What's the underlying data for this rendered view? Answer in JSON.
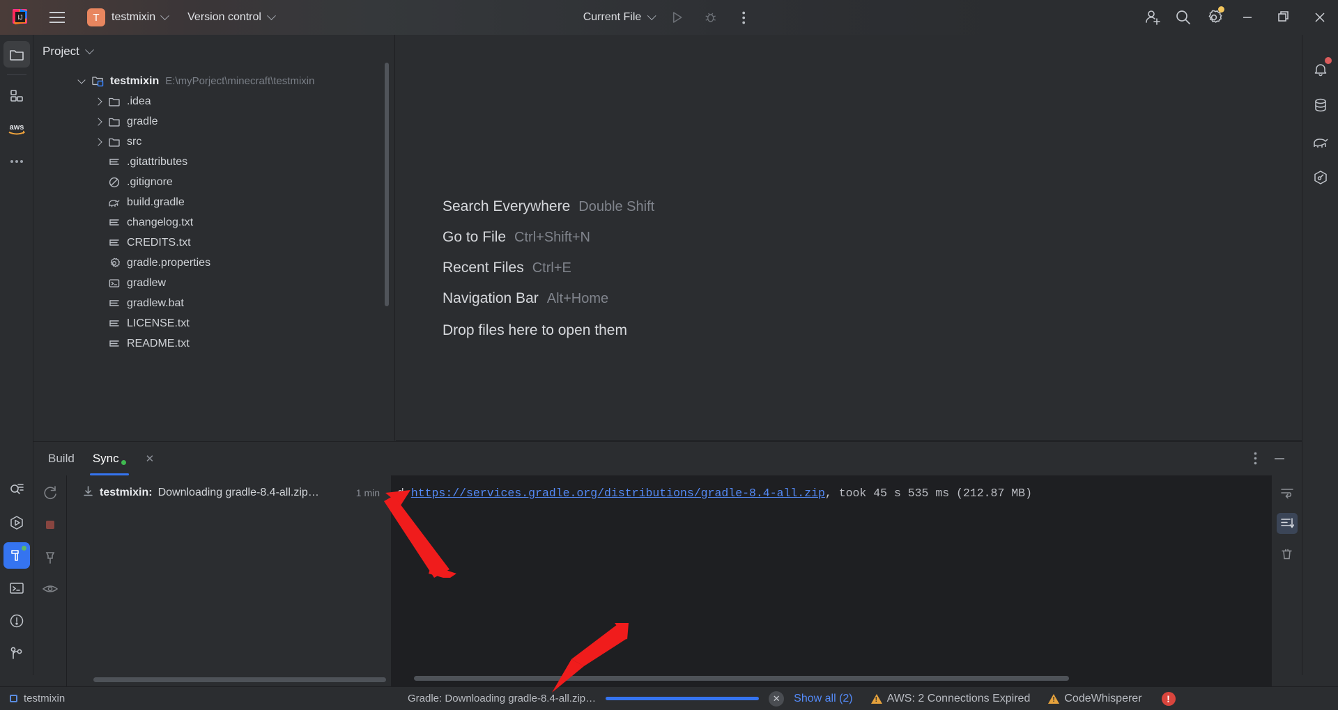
{
  "toolbar": {
    "logo_icon": "intellij-idea-logo",
    "menu_icon": "hamburger-menu-icon",
    "project_badge": "T",
    "project_name": "testmixin",
    "vcs_label": "Version control",
    "run_config": "Current File",
    "run_icon": "run-play-icon",
    "debug_icon": "debug-bug-icon",
    "more_icon": "more-vertical-icon",
    "invite_icon": "add-user-icon",
    "search_icon": "search-icon",
    "settings_icon": "gear-icon",
    "minimize_icon": "window-minimize-icon",
    "maximize_icon": "window-maximize-icon",
    "close_icon": "window-close-icon"
  },
  "left_rail": {
    "items": [
      {
        "name": "project-tool-window",
        "icon": "folder-icon",
        "active": true
      },
      {
        "name": "structure-tool-window",
        "icon": "grid-squares-icon",
        "active": false
      },
      {
        "name": "aws-toolkit",
        "icon": "aws-logo-icon",
        "active": false
      },
      {
        "name": "more-tool-windows",
        "icon": "ellipsis-icon",
        "active": false
      }
    ],
    "bottom_items": [
      {
        "name": "find-tool-window",
        "icon": "find-search-document-icon",
        "active": false
      },
      {
        "name": "run-tool-window",
        "icon": "hexagon-play-icon",
        "active": false
      },
      {
        "name": "build-tool-window",
        "icon": "hammer-icon",
        "active": true,
        "badge": "green-dot"
      },
      {
        "name": "terminal-tool-window",
        "icon": "terminal-icon",
        "active": false
      },
      {
        "name": "problems-tool-window",
        "icon": "exclamation-circle-icon",
        "active": false
      },
      {
        "name": "git-tool-window",
        "icon": "git-branch-icon",
        "active": false
      }
    ]
  },
  "right_rail": {
    "items": [
      {
        "name": "notifications",
        "icon": "bell-icon",
        "badge": "red-dot"
      },
      {
        "name": "database",
        "icon": "database-icon",
        "badge": ""
      },
      {
        "name": "gradle",
        "icon": "gradle-elephant-icon",
        "badge": ""
      },
      {
        "name": "maven",
        "icon": "hexagon-maven-icon",
        "badge": ""
      }
    ]
  },
  "project_panel": {
    "title": "Project",
    "chevron_icon": "chevron-down-icon",
    "tree": [
      {
        "indent": 0,
        "arrow": "down",
        "icon": "module-folder-icon",
        "label": "testmixin",
        "bold": true,
        "path": "E:\\myPorject\\minecraft\\testmixin"
      },
      {
        "indent": 1,
        "arrow": "right",
        "icon": "folder-icon",
        "label": ".idea",
        "bold": false,
        "path": ""
      },
      {
        "indent": 1,
        "arrow": "right",
        "icon": "folder-icon",
        "label": "gradle",
        "bold": false,
        "path": ""
      },
      {
        "indent": 1,
        "arrow": "right",
        "icon": "folder-icon",
        "label": "src",
        "bold": false,
        "path": ""
      },
      {
        "indent": 1,
        "arrow": "none",
        "icon": "text-file-icon",
        "label": ".gitattributes",
        "bold": false,
        "path": ""
      },
      {
        "indent": 1,
        "arrow": "none",
        "icon": "gitignore-icon",
        "label": ".gitignore",
        "bold": false,
        "path": ""
      },
      {
        "indent": 1,
        "arrow": "none",
        "icon": "gradle-elephant-icon",
        "label": "build.gradle",
        "bold": false,
        "path": ""
      },
      {
        "indent": 1,
        "arrow": "none",
        "icon": "text-file-icon",
        "label": "changelog.txt",
        "bold": false,
        "path": ""
      },
      {
        "indent": 1,
        "arrow": "none",
        "icon": "text-file-icon",
        "label": "CREDITS.txt",
        "bold": false,
        "path": ""
      },
      {
        "indent": 1,
        "arrow": "none",
        "icon": "properties-gear-icon",
        "label": "gradle.properties",
        "bold": false,
        "path": ""
      },
      {
        "indent": 1,
        "arrow": "none",
        "icon": "shell-script-icon",
        "label": "gradlew",
        "bold": false,
        "path": ""
      },
      {
        "indent": 1,
        "arrow": "none",
        "icon": "text-file-icon",
        "label": "gradlew.bat",
        "bold": false,
        "path": ""
      },
      {
        "indent": 1,
        "arrow": "none",
        "icon": "text-file-icon",
        "label": "LICENSE.txt",
        "bold": false,
        "path": ""
      },
      {
        "indent": 1,
        "arrow": "none",
        "icon": "text-file-icon",
        "label": "README.txt",
        "bold": false,
        "path": ""
      }
    ]
  },
  "editor": {
    "hints": [
      {
        "name": "Search Everywhere",
        "key": "Double Shift"
      },
      {
        "name": "Go to File",
        "key": "Ctrl+Shift+N"
      },
      {
        "name": "Recent Files",
        "key": "Ctrl+E"
      },
      {
        "name": "Navigation Bar",
        "key": "Alt+Home"
      }
    ],
    "drop_hint": "Drop files here to open them"
  },
  "build_panel": {
    "tabs": [
      {
        "label": "Build",
        "active": false,
        "has_dot": false,
        "closable": false
      },
      {
        "label": "Sync",
        "active": true,
        "has_dot": true,
        "closable": true
      }
    ],
    "close_icon": "close-icon",
    "options_icon": "more-vertical-icon",
    "minimize_icon": "minimize-icon",
    "gutter_icons": [
      {
        "name": "rerun-sync-icon"
      },
      {
        "name": "stop-icon"
      },
      {
        "name": "pin-icon"
      },
      {
        "name": "eye-icon"
      }
    ],
    "tree_row": {
      "icon": "download-icon",
      "title": "testmixin:",
      "detail": " Downloading gradle-8.4-all.zip…",
      "time": "1 min"
    },
    "console": {
      "prefix": "d ",
      "link": "https://services.gradle.org/distributions/gradle-8.4-all.zip",
      "suffix": ", took 45 s 535 ms (212.87 MB)"
    },
    "console_toolbar": [
      {
        "name": "soft-wrap-icon",
        "selected": false
      },
      {
        "name": "scroll-to-end-icon",
        "selected": true
      },
      {
        "name": "clear-all-icon",
        "selected": false
      }
    ]
  },
  "status_bar": {
    "project": "testmixin",
    "project_icon": "project-square-icon",
    "progress_text": "Gradle: Downloading gradle-8.4-all.zip…",
    "progress_percent": 100,
    "cancel_icon": "cancel-x-icon",
    "show_all": "Show all (2)",
    "warnings": [
      {
        "icon": "warning-triangle-icon",
        "label": "AWS: 2 Connections Expired"
      },
      {
        "icon": "warning-triangle-icon",
        "label": "CodeWhisperer"
      }
    ],
    "error_icon": "error-exclamation-icon"
  },
  "annotations": {
    "arrow_color": "#f01c1c",
    "arrows": [
      {
        "name": "arrow-to-build-tree-row"
      },
      {
        "name": "arrow-to-status-progress"
      }
    ]
  }
}
